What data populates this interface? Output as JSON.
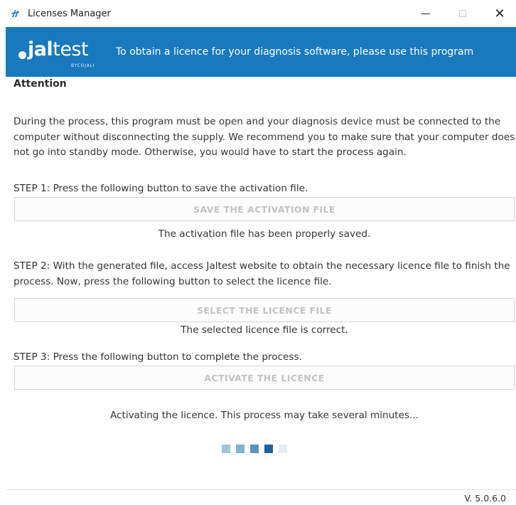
{
  "window": {
    "title": "Licenses Manager",
    "minimize": "—",
    "maximize": "□",
    "close": "✕"
  },
  "banner": {
    "logo_main_light": "•",
    "logo_main_bold": "jal",
    "logo_main_rest": "test",
    "logo_sub": "BYCOJALI",
    "message": "To obtain a licence for your diagnosis software, please use this program"
  },
  "content": {
    "attention": "Attention",
    "paragraph": "During the process, this program must be open and your diagnosis device must be connected to the computer without disconnecting the supply. We recommend you to make sure that your computer does not go into standby mode. Otherwise, you would have to start the process again.",
    "step1": {
      "text": "STEP 1: Press the following button to save the activation file.",
      "button": "SAVE THE ACTIVATION FILE",
      "status": "The activation file has been properly saved."
    },
    "step2": {
      "text": "STEP 2: With the generated file, access Jaltest website to obtain the necessary licence file to finish the process. Now, press the following button to select the licence file.",
      "button": "SELECT THE LICENCE FILE",
      "status": "The selected licence file is correct."
    },
    "step3": {
      "text": "STEP 3: Press the following button to complete the process.",
      "button": "ACTIVATE THE LICENCE",
      "status": "Activating the licence. This process may take several minutes..."
    }
  },
  "loader": {
    "colors": [
      "#9cc6dc",
      "#7fb3cf",
      "#5596bd",
      "#1f5f9e",
      "#e3eef5"
    ]
  },
  "footer": {
    "version": "V. 5.0.6.0"
  },
  "colors": {
    "banner": "#1979bd",
    "disabled_text": "#c2c2c2"
  }
}
